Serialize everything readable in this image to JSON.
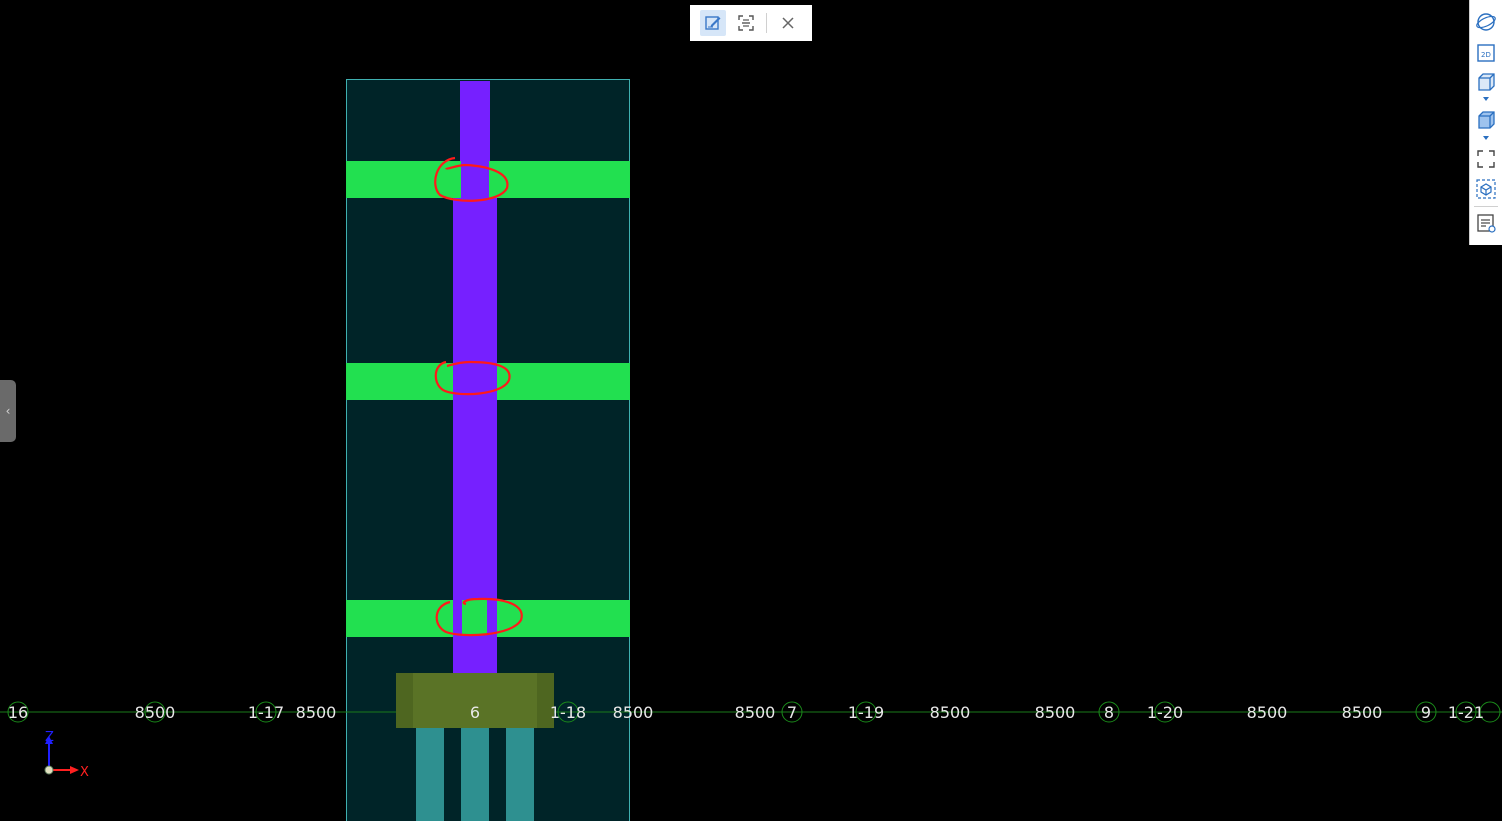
{
  "top_toolbar": {
    "buttons": [
      {
        "name": "edit-annotation",
        "active": true
      },
      {
        "name": "screen-capture",
        "active": false
      },
      {
        "name": "close",
        "active": false
      }
    ]
  },
  "right_toolbar": {
    "view_2d_label": "2D"
  },
  "axis": {
    "x_label": "X",
    "z_label": "Z"
  },
  "gridline_labels": [
    {
      "text": "16",
      "kind": "dim"
    },
    {
      "text": "8500",
      "kind": "dim"
    },
    {
      "text": "1-17",
      "kind": "axis"
    },
    {
      "text": "8500",
      "kind": "dim"
    },
    {
      "text": "6",
      "kind": "axis"
    },
    {
      "text": "1-18",
      "kind": "axis"
    },
    {
      "text": "8500",
      "kind": "dim"
    },
    {
      "text": "8500",
      "kind": "dim"
    },
    {
      "text": "7",
      "kind": "axis"
    },
    {
      "text": "1-19",
      "kind": "axis"
    },
    {
      "text": "8500",
      "kind": "dim"
    },
    {
      "text": "8500",
      "kind": "dim"
    },
    {
      "text": "8",
      "kind": "axis"
    },
    {
      "text": "1-20",
      "kind": "axis"
    },
    {
      "text": "8500",
      "kind": "dim"
    },
    {
      "text": "8500",
      "kind": "dim"
    },
    {
      "text": "9",
      "kind": "axis"
    },
    {
      "text": "1-21",
      "kind": "axis"
    }
  ],
  "colors": {
    "background": "#000000",
    "section_panel": "#002428",
    "section_border": "#3fb0b0",
    "beam": "#22e050",
    "column": "#7620ff",
    "pile_cap": "#4e6620",
    "pile": "#2e9090",
    "gridline": "#1a7a1a",
    "markup": "#ff1a1a",
    "axis_x": "#ff2020",
    "axis_z": "#2020ff"
  }
}
